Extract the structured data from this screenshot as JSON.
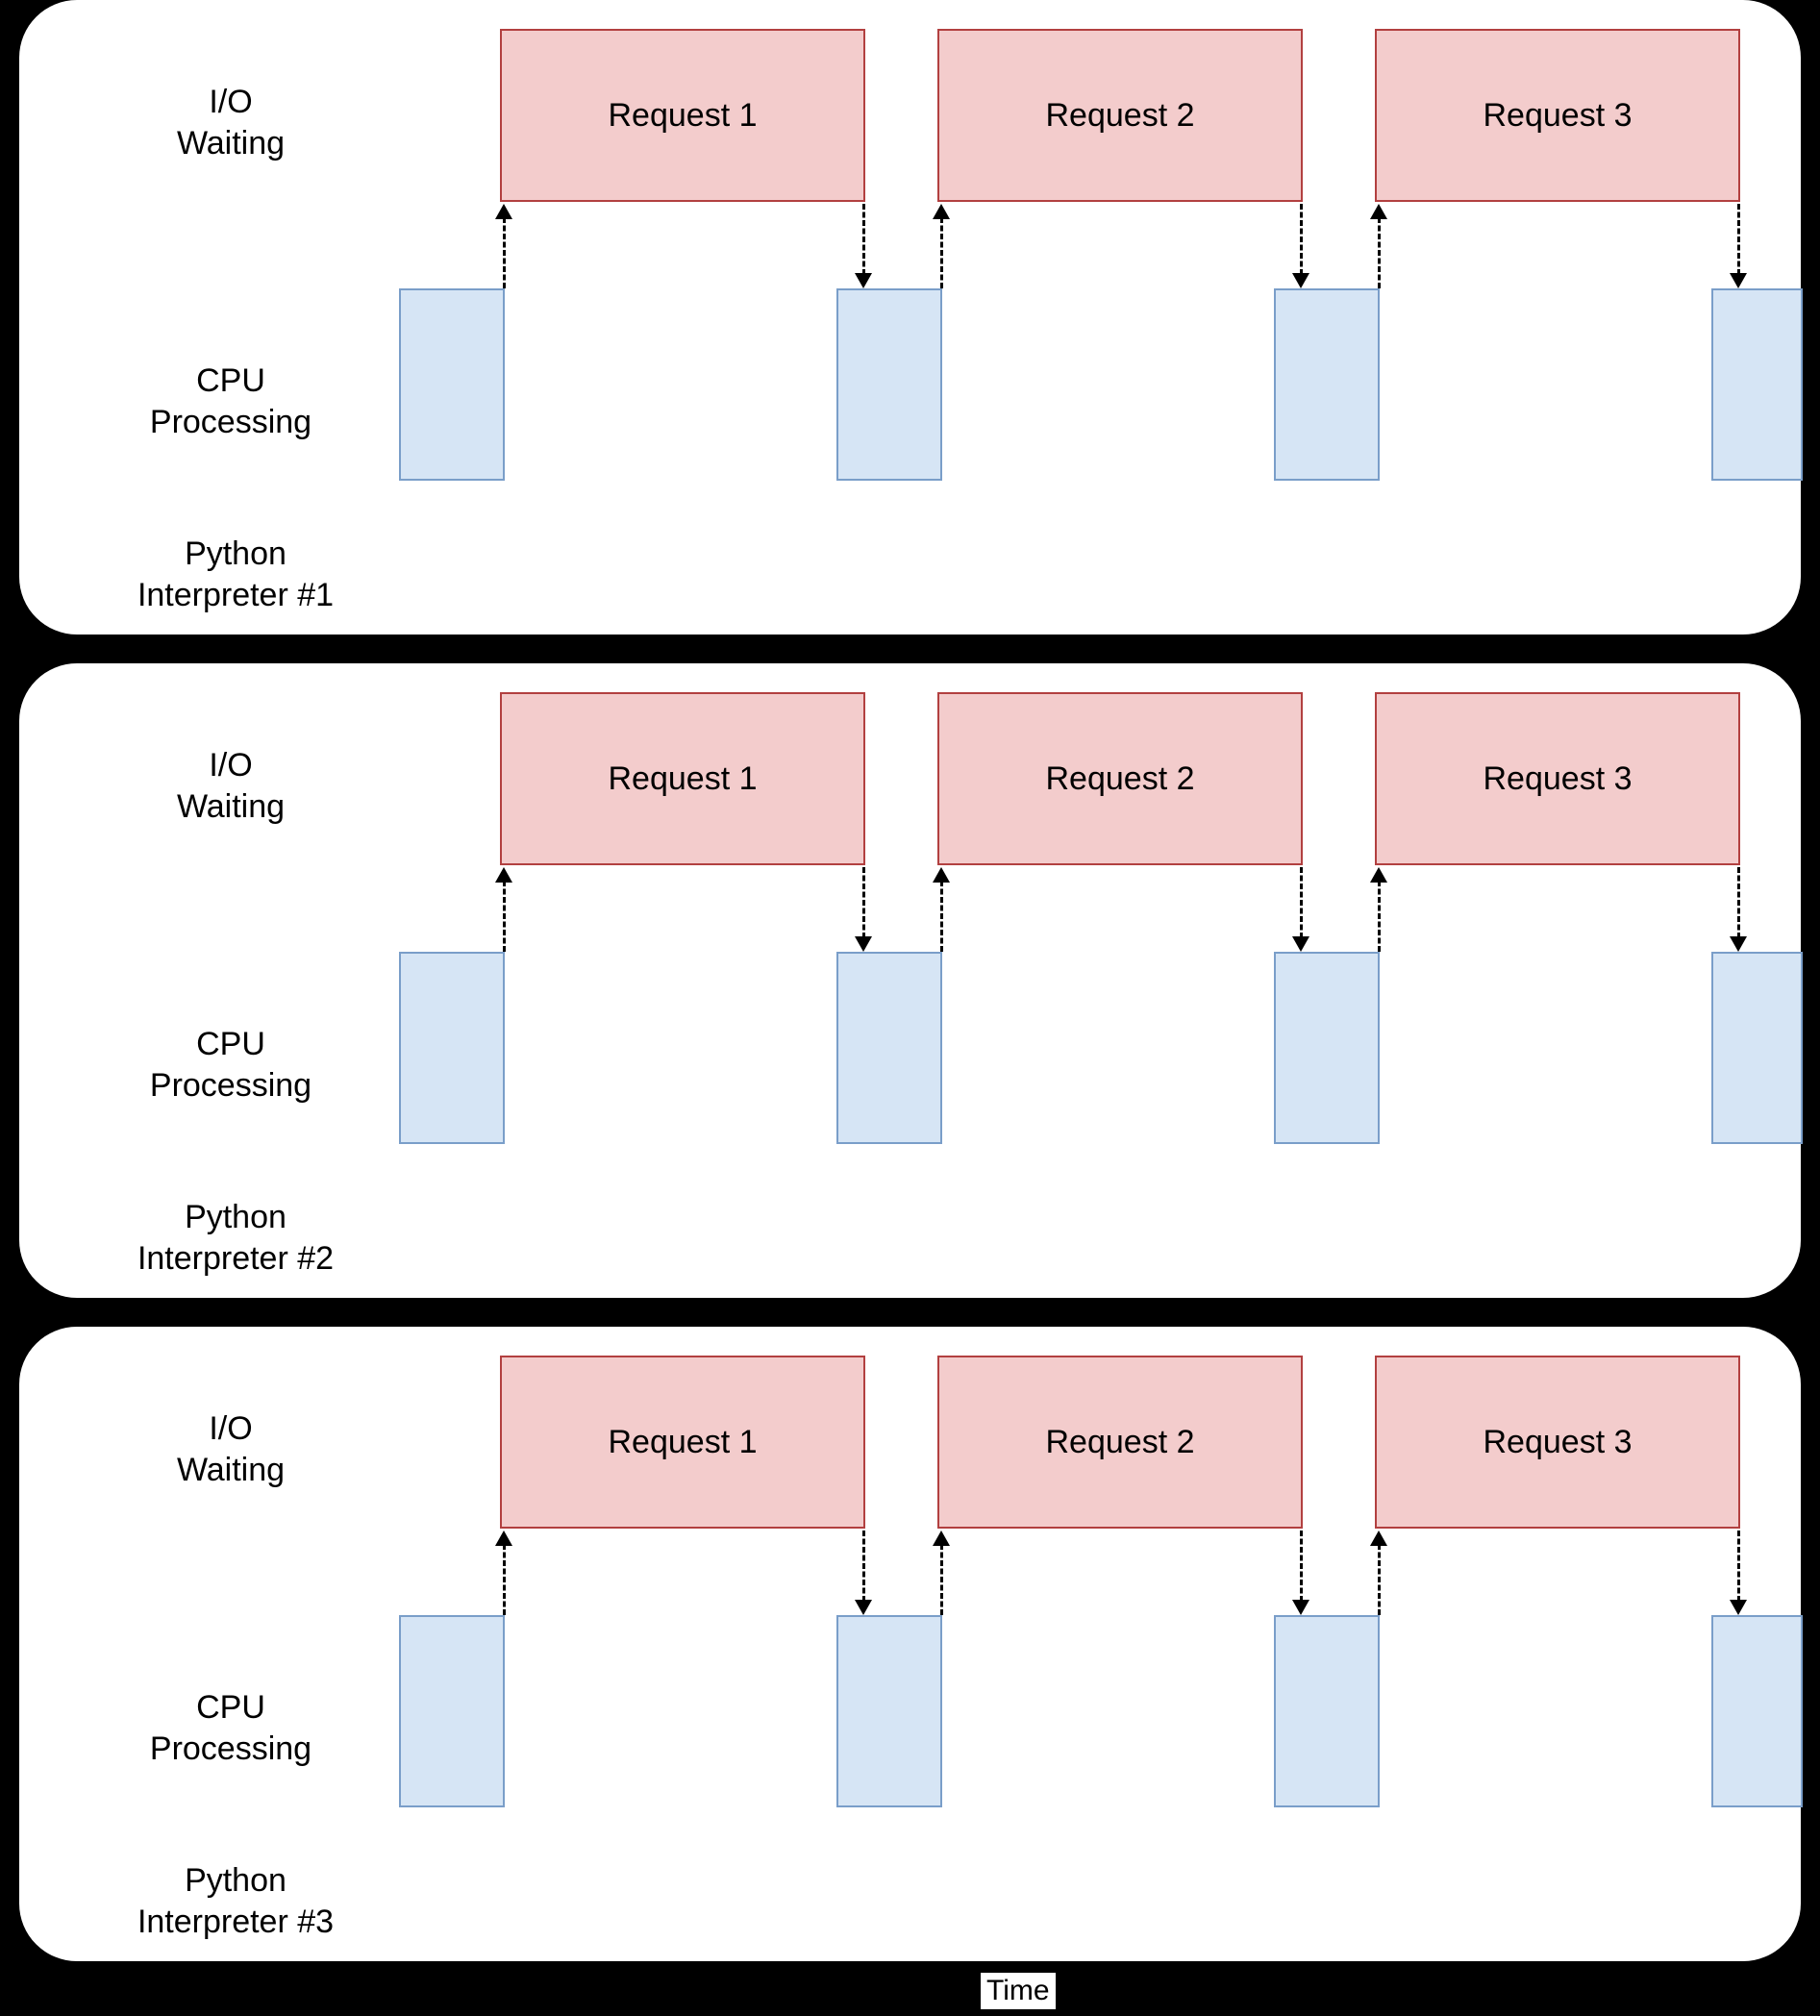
{
  "labels": {
    "io": "I/O\nWaiting",
    "cpu": "CPU\nProcessing",
    "time": "Time"
  },
  "panels": [
    {
      "interpreter": "Python\nInterpreter #1",
      "requests": [
        "Request 1",
        "Request 2",
        "Request 3"
      ]
    },
    {
      "interpreter": "Python\nInterpreter #2",
      "requests": [
        "Request 1",
        "Request 2",
        "Request 3"
      ]
    },
    {
      "interpreter": "Python\nInterpreter #3",
      "requests": [
        "Request 1",
        "Request 2",
        "Request 3"
      ]
    }
  ],
  "colors": {
    "io_fill": "#f3cccc",
    "io_stroke": "#b24040",
    "cpu_fill": "#d6e5f5",
    "cpu_stroke": "#7a9ec9",
    "panel_bg": "#ffffff",
    "page_bg": "#000000"
  }
}
